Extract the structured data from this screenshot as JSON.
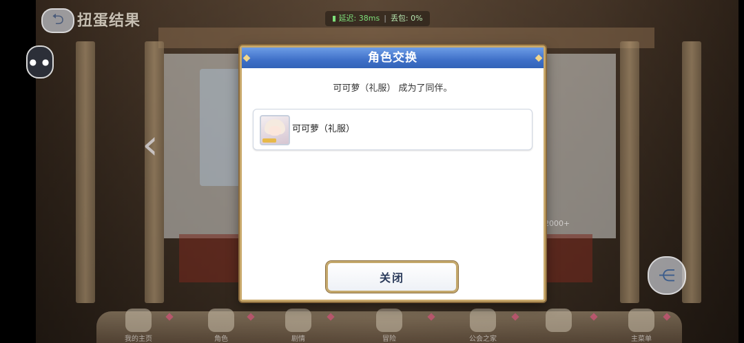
{
  "top": {
    "title": "扭蛋结果",
    "latency_label": "延迟: 38ms",
    "loss_label": "丢包: 0%"
  },
  "background": {
    "panel_note": "2000+"
  },
  "dialog": {
    "title": "角色交换",
    "message": "可可萝（礼服） 成为了同伴。",
    "result": {
      "character_name": "可可萝（礼服）",
      "icon": "character-portrait-icon"
    },
    "close_label": "关闭"
  },
  "bottom_menu": {
    "items": [
      {
        "label": "我的主页"
      },
      {
        "label": "角色"
      },
      {
        "label": "剧情"
      },
      {
        "label": "冒险"
      },
      {
        "label": "公会之家"
      },
      {
        "label": ""
      },
      {
        "label": "主菜单"
      }
    ]
  },
  "colors": {
    "dialog_header": "#3f70c8",
    "dialog_border": "#c8a86a",
    "net_stat": "#7ee07a"
  }
}
